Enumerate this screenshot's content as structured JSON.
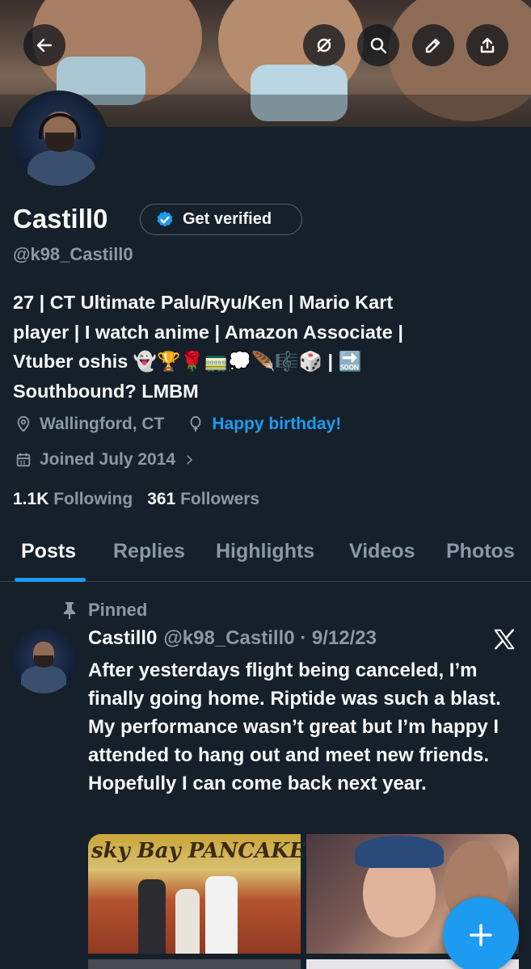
{
  "profile": {
    "name": "Castill0",
    "handle": "@k98_Castill0",
    "verify_label": "Get verified",
    "bio_lines": [
      "27 | CT Ultimate Palu/Ryu/Ken | Mario Kart",
      "player | I watch anime | Amazon Associate |",
      "Vtuber oshis 👻🏆🌹🚃💭🪶🎼🎲 | 🔜",
      "Southbound? LMBM"
    ],
    "location": "Wallingford, CT",
    "birthday": "Happy birthday!",
    "joined": "Joined July 2014",
    "following_count": "1.1K",
    "following_label": "Following",
    "followers_count": "361",
    "followers_label": "Followers"
  },
  "header_icons": [
    "back-arrow-icon",
    "hide-icon",
    "search-icon",
    "edit-icon",
    "share-icon"
  ],
  "tabs": [
    "Posts",
    "Replies",
    "Highlights",
    "Videos",
    "Photos"
  ],
  "active_tab": "Posts",
  "post": {
    "pinned_label": "Pinned",
    "author": "Castill0",
    "handle_date": "@k98_Castill0 · 9/12/23",
    "text": "After yesterdays flight being canceled, I’m finally going home. Riptide was such a blast. My performance wasn’t great but I’m happy I attended to hang out and meet new friends. Hopefully I can come back next year.",
    "media_sign_text": "sky Bay PANCAKE"
  },
  "colors": {
    "background": "#15202b",
    "accent": "#1d9bf0",
    "muted_text": "#8b98a5",
    "primary_text": "#f7f9f9"
  }
}
